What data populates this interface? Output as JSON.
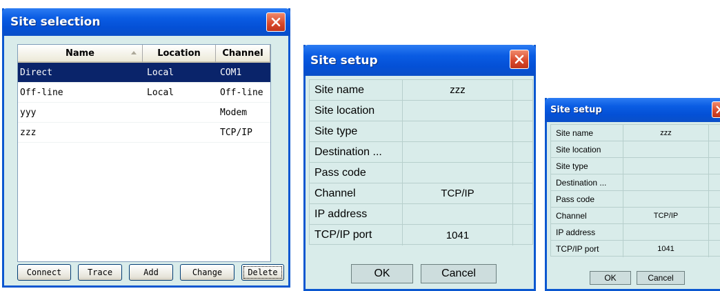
{
  "site_selection": {
    "title": "Site selection",
    "columns": [
      "Name",
      "Location",
      "Channel"
    ],
    "rows": [
      {
        "name": "Direct",
        "location": "Local",
        "channel": "COM1",
        "selected": true
      },
      {
        "name": "Off-line",
        "location": "Local",
        "channel": "Off-line",
        "selected": false
      },
      {
        "name": "yyy",
        "location": "",
        "channel": "Modem",
        "selected": false
      },
      {
        "name": "zzz",
        "location": "",
        "channel": "TCP/IP",
        "selected": false
      }
    ],
    "buttons": [
      "Connect",
      "Trace",
      "Add",
      "Change",
      "Delete"
    ]
  },
  "site_setup": {
    "title": "Site setup",
    "fields": [
      {
        "label": "Site name",
        "value": "zzz"
      },
      {
        "label": "Site location",
        "value": ""
      },
      {
        "label": "Site type",
        "value": ""
      },
      {
        "label": "Destination ...",
        "value": ""
      },
      {
        "label": "Pass code",
        "value": ""
      },
      {
        "label": "Channel",
        "value": "TCP/IP"
      },
      {
        "label": "IP address",
        "value": ""
      },
      {
        "label": "TCP/IP port",
        "value": "1041"
      }
    ],
    "ok_label": "OK",
    "cancel_label": "Cancel"
  },
  "colors": {
    "titlebar": "#0a5ce3",
    "selection": "#0a246a",
    "dialog_bg": "#d9ecea",
    "close_button": "#d8472a"
  },
  "icons": [
    "close-icon",
    "sort-ascending-icon"
  ]
}
